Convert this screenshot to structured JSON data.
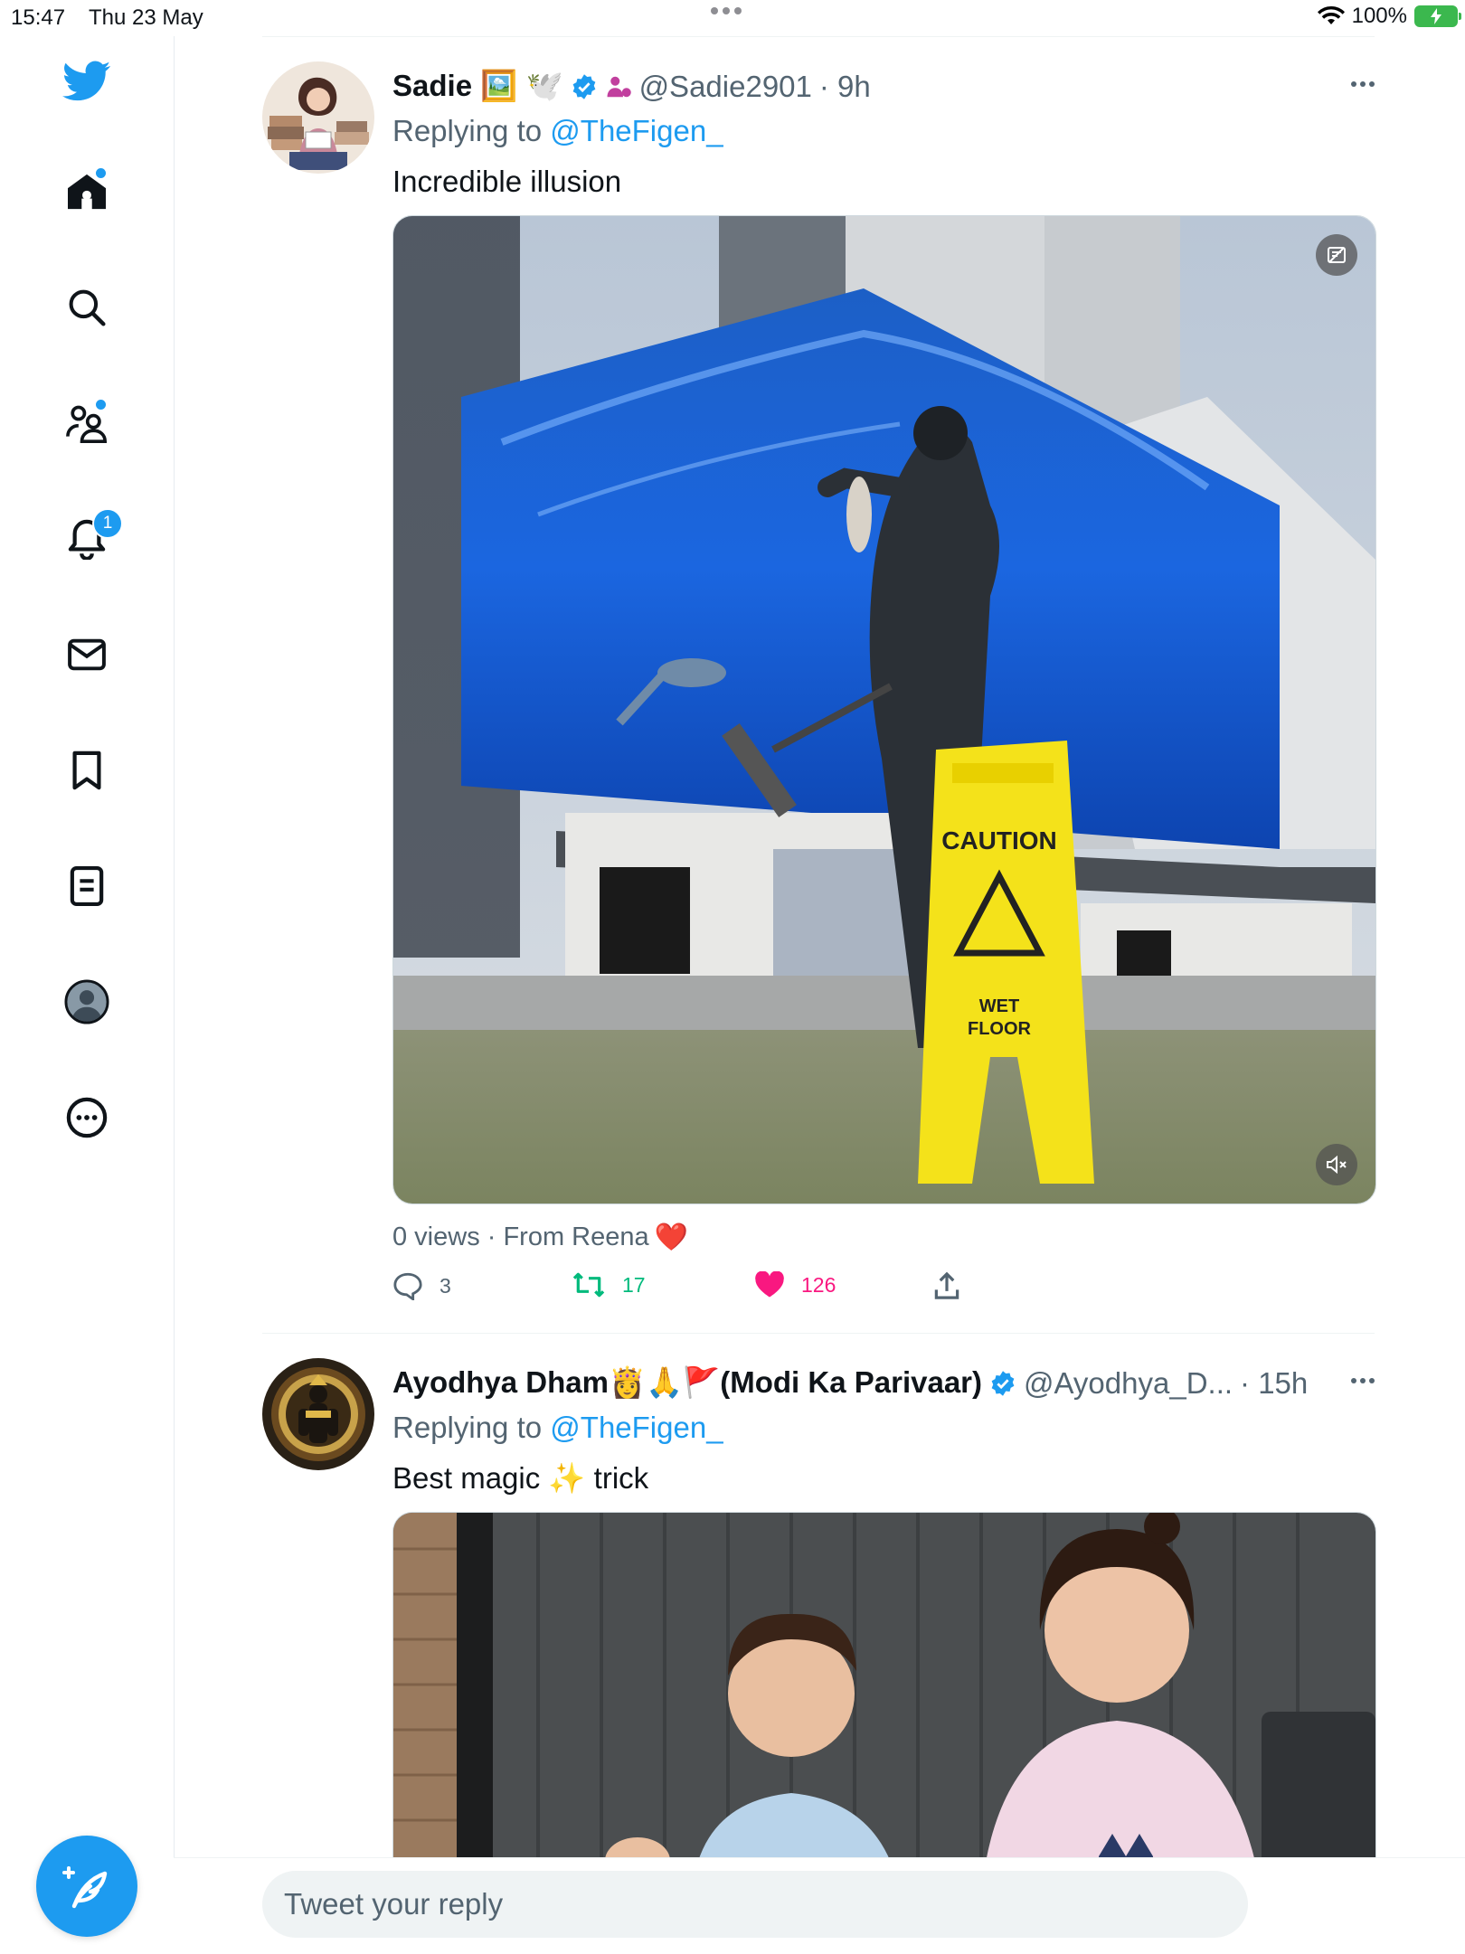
{
  "status_bar": {
    "time": "15:47",
    "date": "Thu 23 May",
    "battery": "100%"
  },
  "sidebar": {
    "notification_count": "1",
    "items": [
      "home-icon",
      "search-icon",
      "communities-icon",
      "notifications-icon",
      "messages-icon",
      "bookmarks-icon",
      "lists-icon",
      "profile-icon",
      "more-icon"
    ]
  },
  "colors": {
    "accent": "#1d9bf0",
    "like": "#f91880",
    "retweet": "#00ba7c",
    "secondary_text": "#536471"
  },
  "tweets": [
    {
      "name": "Sadie 🖼️ 🕊️",
      "handle": "@Sadie2901",
      "time": "· 9h",
      "replying_label": "Replying to",
      "replying_to": "@TheFigen_",
      "text": "Incredible illusion",
      "views": "0 views · From Reena",
      "views_emoji": "❤️",
      "replies": "3",
      "retweets": "17",
      "likes": "126"
    },
    {
      "name": "Ayodhya Dham👸🙏🚩(Modi Ka Parivaar)",
      "handle": "@Ayodhya_D...",
      "time": "· 15h",
      "replying_label": "Replying to",
      "replying_to": "@TheFigen_",
      "text_before": "Best magic",
      "text_emoji": "✨",
      "text_after": "trick"
    }
  ],
  "reply_bar": {
    "placeholder": "Tweet your reply"
  }
}
